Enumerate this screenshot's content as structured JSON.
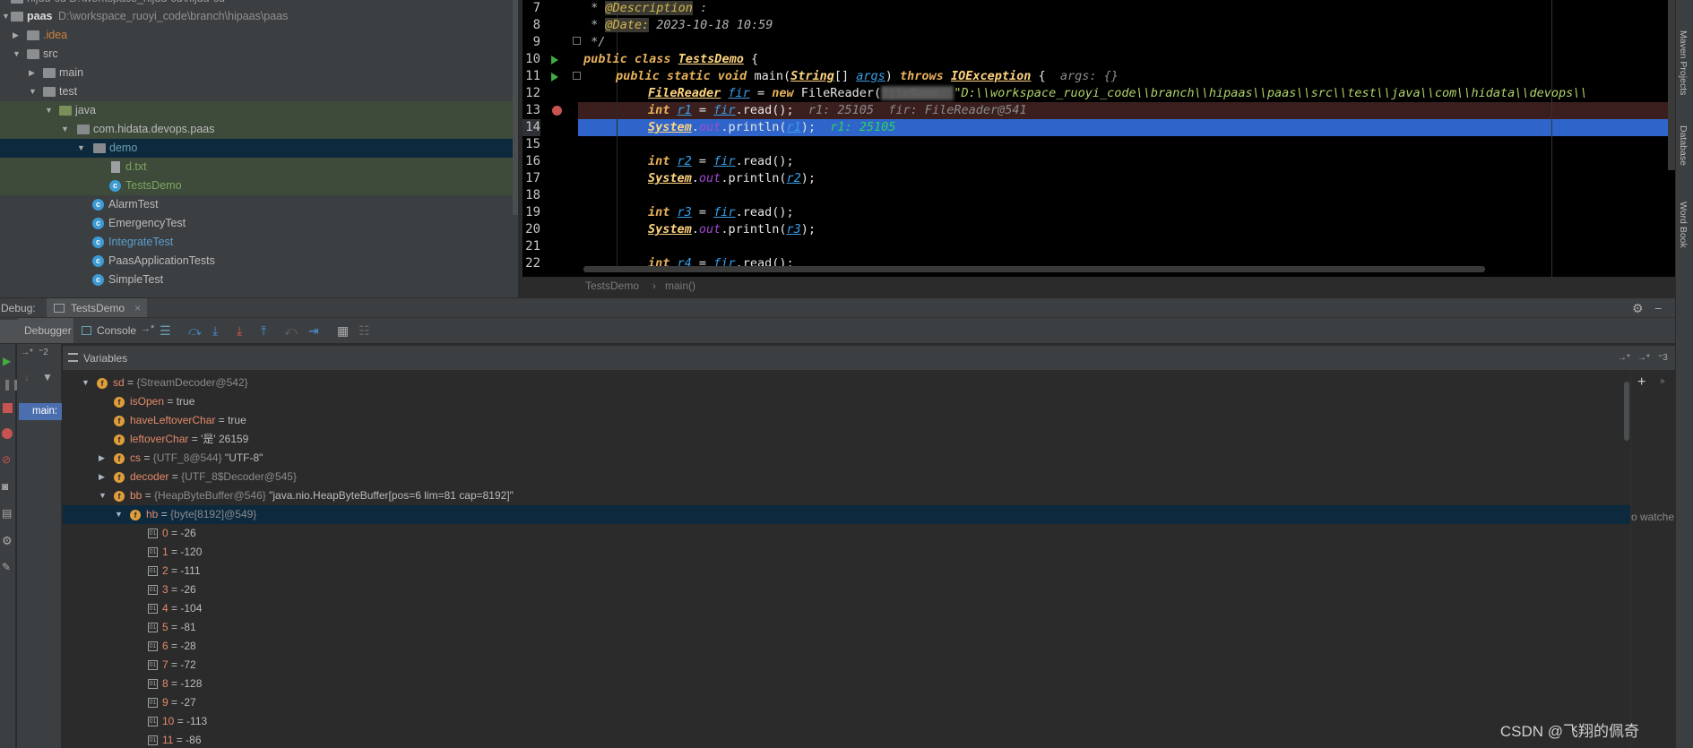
{
  "project_tree": {
    "top_clipped": "hijdd-cu  D:\\workspace_hijdd-cu\\hijdd-cu",
    "root_name": "paas",
    "root_path": "D:\\workspace_ruoyi_code\\branch\\hipaas\\paas",
    "items": [
      {
        "label": ".idea"
      },
      {
        "label": "src"
      },
      {
        "label": "main"
      },
      {
        "label": "test"
      },
      {
        "label": "java"
      },
      {
        "label": "com.hidata.devops.paas"
      },
      {
        "label": "demo"
      },
      {
        "label": "d.txt"
      },
      {
        "label": "TestsDemo"
      },
      {
        "label": "AlarmTest"
      },
      {
        "label": "EmergencyTest"
      },
      {
        "label": "IntegrateTest"
      },
      {
        "label": "PaasApplicationTests"
      },
      {
        "label": "SimpleTest"
      }
    ]
  },
  "editor": {
    "line_numbers": [
      "7",
      "8",
      "9",
      "10",
      "11",
      "12",
      "13",
      "14",
      "15",
      "16",
      "17",
      "18",
      "19",
      "20",
      "21",
      "22"
    ],
    "code": {
      "l7_star": " * ",
      "l7_ann": "@Description",
      "l7_rest": " :",
      "l8_star": " * ",
      "l8_ann": "@Date:",
      "l8_rest": " 2023-10-18 10:59",
      "l9": " */",
      "l10_kw": "public class ",
      "l10_cls": "TestsDemo",
      "l10_rest": " {",
      "l11_kw": "public static void ",
      "l11_main": "main(",
      "l11_type": "String",
      "l11_arr": "[] ",
      "l11_args": "args",
      "l11_close": ") ",
      "l11_throws": "throws ",
      "l11_ex": "IOException",
      "l11_brace": " {  ",
      "l11_hint": "args: {}",
      "l12_type": "FileReader",
      "l12_var": "fir",
      "l12_eq": " = ",
      "l12_new": "new ",
      "l12_ctor": "FileReader(",
      "l12_blur": "fileName: ",
      "l12_str": "\"D:\\\\workspace_ruoyi_code\\\\branch\\\\hipaas\\\\paas\\\\src\\\\test\\\\java\\\\com\\\\hidata\\\\devops\\\\",
      "l13_int": "int ",
      "l13_var": "r1",
      "l13_eq": " = ",
      "l13_fir": "fir",
      "l13_call": ".read();",
      "l13_hint": "  r1: 25105  fir: FileReader@541",
      "l14_sys": "System",
      "l14_dot": ".",
      "l14_out": "out",
      "l14_pl": ".println(",
      "l14_var": "r1",
      "l14_end": ");",
      "l14_hint": "  r1: 25105",
      "l16_int": "int ",
      "l16_var": "r2",
      "l16_eq": " = ",
      "l16_fir": "fir",
      "l16_call": ".read();",
      "l17_sys": "System",
      "l17_dot": ".",
      "l17_out": "out",
      "l17_pl": ".println(",
      "l17_var": "r2",
      "l17_end": ");",
      "l19_int": "int ",
      "l19_var": "r3",
      "l19_eq": " = ",
      "l19_fir": "fir",
      "l19_call": ".read();",
      "l20_sys": "System",
      "l20_dot": ".",
      "l20_out": "out",
      "l20_pl": ".println(",
      "l20_var": "r3",
      "l20_end": ");",
      "l22_int": "int ",
      "l22_var": "r4",
      "l22_eq": " = ",
      "l22_fir": "fir",
      "l22_call": ".read();"
    },
    "breadcrumb": {
      "class": "TestsDemo",
      "sep": "›",
      "method": "main()"
    }
  },
  "right_strip": {
    "maven": "Maven Projects",
    "database": "Database",
    "wordbook": "Word Book"
  },
  "debug": {
    "label": "Debug:",
    "session_tab": "TestsDemo",
    "tabs": {
      "debugger": "Debugger",
      "console": "Console"
    },
    "variables_title": "Variables",
    "frame": "main:",
    "watches_hint": "o watche"
  },
  "variables": [
    {
      "name": "sd",
      "eq": " = ",
      "type": "{StreamDecoder@542}",
      "value": ""
    },
    {
      "name": "isOpen",
      "eq": " = ",
      "type": "",
      "value": "true"
    },
    {
      "name": "haveLeftoverChar",
      "eq": " = ",
      "type": "",
      "value": "true"
    },
    {
      "name": "leftoverChar",
      "eq": " = ",
      "type": "",
      "value": "'是' 26159"
    },
    {
      "name": "cs",
      "eq": " = ",
      "type": "{UTF_8@544}",
      "value": " \"UTF-8\""
    },
    {
      "name": "decoder",
      "eq": " = ",
      "type": "{UTF_8$Decoder@545}",
      "value": ""
    },
    {
      "name": "bb",
      "eq": " = ",
      "type": "{HeapByteBuffer@546}",
      "value": " \"java.nio.HeapByteBuffer[pos=6 lim=81 cap=8192]\""
    },
    {
      "name": "hb",
      "eq": " = ",
      "type": "{byte[8192]@549}",
      "value": ""
    },
    {
      "name": "0",
      "eq": " = ",
      "type": "",
      "value": "-26"
    },
    {
      "name": "1",
      "eq": " = ",
      "type": "",
      "value": "-120"
    },
    {
      "name": "2",
      "eq": " = ",
      "type": "",
      "value": "-111"
    },
    {
      "name": "3",
      "eq": " = ",
      "type": "",
      "value": "-26"
    },
    {
      "name": "4",
      "eq": " = ",
      "type": "",
      "value": "-104"
    },
    {
      "name": "5",
      "eq": " = ",
      "type": "",
      "value": "-81"
    },
    {
      "name": "6",
      "eq": " = ",
      "type": "",
      "value": "-28"
    },
    {
      "name": "7",
      "eq": " = ",
      "type": "",
      "value": "-72"
    },
    {
      "name": "8",
      "eq": " = ",
      "type": "",
      "value": "-128"
    },
    {
      "name": "9",
      "eq": " = ",
      "type": "",
      "value": "-27"
    },
    {
      "name": "10",
      "eq": " = ",
      "type": "",
      "value": "-113"
    },
    {
      "name": "11",
      "eq": " = ",
      "type": "",
      "value": "-86"
    }
  ],
  "watermark": "CSDN @飞翔的佩奇"
}
